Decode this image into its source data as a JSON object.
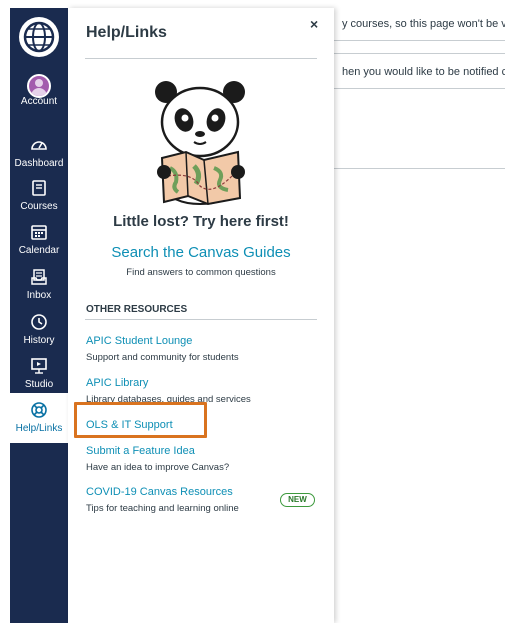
{
  "nav": {
    "items": [
      {
        "label": "Account",
        "icon": "user-avatar-icon"
      },
      {
        "label": "Dashboard",
        "icon": "speedometer-icon"
      },
      {
        "label": "Courses",
        "icon": "book-icon"
      },
      {
        "label": "Calendar",
        "icon": "calendar-icon"
      },
      {
        "label": "Inbox",
        "icon": "inbox-icon"
      },
      {
        "label": "History",
        "icon": "clock-icon"
      },
      {
        "label": "Studio",
        "icon": "studio-icon"
      },
      {
        "label": "Help/Links",
        "icon": "lifebuoy-icon",
        "active": true
      }
    ],
    "colors": {
      "background": "#1a2b4f",
      "active_text": "#0770a3"
    }
  },
  "background": {
    "line1": "y courses, so this page won't be ve",
    "line2": "hen you would like to be notified c"
  },
  "tray": {
    "title": "Help/Links",
    "close": "×",
    "lost_heading": "Little lost? Try here first!",
    "search_guides": "Search the Canvas Guides",
    "search_sub": "Find answers to common questions",
    "section_heading": "OTHER RESOURCES",
    "resources": [
      {
        "title": "APIC Student Lounge",
        "desc": "Support and community for students"
      },
      {
        "title": "APIC Library",
        "desc": "Library databases, guides and services"
      },
      {
        "title": "OLS & IT Support",
        "desc": ""
      },
      {
        "title": "Submit a Feature Idea",
        "desc": "Have an idea to improve Canvas?"
      },
      {
        "title": "COVID-19 Canvas Resources",
        "desc": "Tips for teaching and learning online",
        "badge": "NEW"
      }
    ],
    "colors": {
      "link": "#0e8fb5",
      "highlight": "#d9731f",
      "badge": "#3d9a3d"
    }
  }
}
